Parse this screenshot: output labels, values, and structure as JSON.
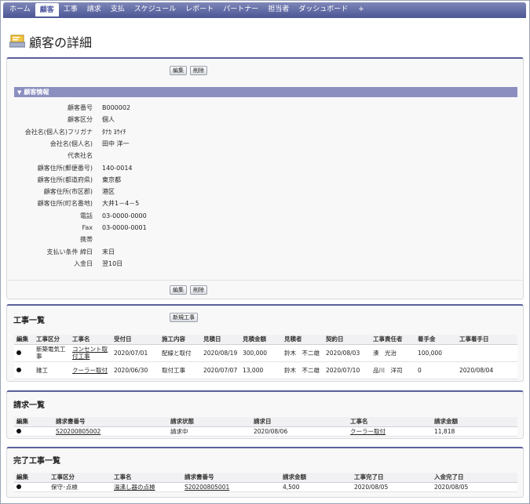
{
  "tabs": [
    {
      "label": "ホーム",
      "active": false
    },
    {
      "label": "顧客",
      "active": true
    },
    {
      "label": "工事",
      "active": false
    },
    {
      "label": "請求",
      "active": false
    },
    {
      "label": "支払",
      "active": false
    },
    {
      "label": "スケジュール",
      "active": false
    },
    {
      "label": "レポート",
      "active": false
    },
    {
      "label": "パートナー",
      "active": false
    },
    {
      "label": "担当者",
      "active": false
    },
    {
      "label": "ダッシュボード",
      "active": false
    },
    {
      "label": "+",
      "active": false
    }
  ],
  "page": {
    "title": "顧客の詳細"
  },
  "detail": {
    "edit_label": "編集",
    "delete_label": "削除",
    "section_label": "顧客情報",
    "fields": [
      {
        "label": "顧客番号",
        "value": "B000002"
      },
      {
        "label": "顧客区分",
        "value": "個人"
      },
      {
        "label": "会社名(個人名)フリガナ",
        "value": "ﾀﾅｶ ﾖｳｲﾁ"
      },
      {
        "label": "会社名(個人名)",
        "value": "田中 洋一"
      },
      {
        "label": "代表社名",
        "value": ""
      },
      {
        "label": "顧客住所(郵便番号)",
        "value": "140-0014"
      },
      {
        "label": "顧客住所(都道府県)",
        "value": "東京都"
      },
      {
        "label": "顧客住所(市区郡)",
        "value": "港区"
      },
      {
        "label": "顧客住所(町名番地)",
        "value": "大井1－4－5"
      },
      {
        "label": "電話",
        "value": "03-0000-0000"
      },
      {
        "label": "Fax",
        "value": "03-0000-0001"
      },
      {
        "label": "携帯",
        "value": ""
      },
      {
        "label": "支払い条件 締日",
        "value": "末日"
      },
      {
        "label": "入金日",
        "value": "翌10日"
      }
    ]
  },
  "construction": {
    "title": "工事一覧",
    "new_label": "新規工事",
    "headers": [
      "編集",
      "工事区分",
      "工事名",
      "受付日",
      "施工内容",
      "見積日",
      "見積金額",
      "見積者",
      "契約日",
      "工事責任者",
      "着手金",
      "工事着手日"
    ],
    "rows": [
      [
        "●",
        "新築電気工事",
        "コンセント取付工事",
        "2020/07/01",
        "配線と取付",
        "2020/08/19",
        "300,000",
        "鈴木　不二雄",
        "2020/08/03",
        "湊　光治",
        "100,000",
        ""
      ],
      [
        "●",
        "雑工",
        "クーラー取付",
        "2020/06/30",
        "取付工事",
        "2020/07/07",
        "13,000",
        "鈴木　不二雄",
        "2020/07/10",
        "品川　洋司",
        "0",
        "2020/08/04"
      ]
    ]
  },
  "invoices": {
    "title": "請求一覧",
    "headers": [
      "編集",
      "請求書番号",
      "請求状態",
      "請求日",
      "工事名",
      "請求金額"
    ],
    "rows": [
      [
        "●",
        "S20200805002",
        "請求中",
        "2020/08/06",
        "クーラー取付",
        "11,818"
      ]
    ]
  },
  "completed": {
    "title": "完了工事一覧",
    "headers": [
      "編集",
      "工事区分",
      "工事名",
      "請求書番号",
      "請求金額",
      "工事完了日",
      "入金完了日"
    ],
    "rows": [
      [
        "●",
        "保守･点検",
        "湯沸し器の点検",
        "S20200805001",
        "4,500",
        "2020/08/05",
        "2020/08/05"
      ]
    ]
  }
}
